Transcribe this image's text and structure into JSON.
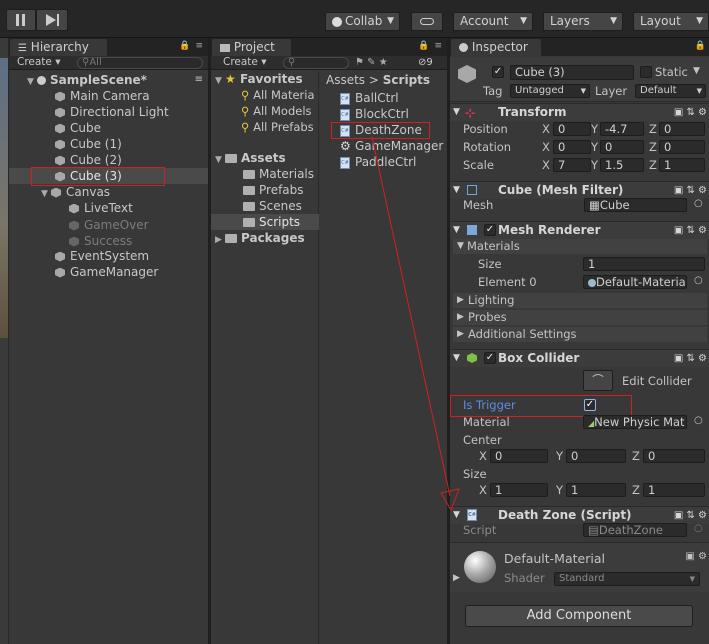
{
  "toolbar": {
    "collab": "Collab",
    "account": "Account",
    "layers": "Layers",
    "layout": "Layout"
  },
  "hierarchy": {
    "tab": "Hierarchy",
    "create": "Create",
    "search_placeholder": "All",
    "scene": "SampleScene*",
    "items": [
      "Main Camera",
      "Directional Light",
      "Cube",
      "Cube (1)",
      "Cube (2)",
      "Cube (3)",
      "Canvas",
      "LiveText",
      "GameOver",
      "Success",
      "EventSystem",
      "GameManager"
    ]
  },
  "project": {
    "tab": "Project",
    "create": "Create",
    "count": "9",
    "favorites": "Favorites",
    "fav_items": [
      "All Materia",
      "All Models",
      "All Prefabs"
    ],
    "assets": "Assets",
    "asset_folders": [
      "Materials",
      "Prefabs",
      "Scenes",
      "Scripts"
    ],
    "packages": "Packages",
    "breadcrumb_root": "Assets",
    "breadcrumb_sep": ">",
    "breadcrumb_current": "Scripts",
    "files": [
      "BallCtrl",
      "BlockCtrl",
      "DeathZone",
      "GameManager",
      "PaddleCtrl"
    ]
  },
  "inspector": {
    "tab": "Inspector",
    "object_name": "Cube (3)",
    "static_label": "Static",
    "tag_label": "Tag",
    "tag_value": "Untagged",
    "layer_label": "Layer",
    "layer_value": "Default",
    "transform": {
      "title": "Transform",
      "position_label": "Position",
      "rotation_label": "Rotation",
      "scale_label": "Scale",
      "axis_x": "X",
      "axis_y": "Y",
      "axis_z": "Z",
      "position": [
        "0",
        "-4.7",
        "0"
      ],
      "rotation": [
        "0",
        "0",
        "0"
      ],
      "scale": [
        "7",
        "1.5",
        "1"
      ]
    },
    "mesh_filter": {
      "title": "Cube (Mesh Filter)",
      "mesh_label": "Mesh",
      "mesh_value": "Cube"
    },
    "mesh_renderer": {
      "title": "Mesh Renderer",
      "materials_label": "Materials",
      "size_label": "Size",
      "size_value": "1",
      "element_label": "Element 0",
      "element_value": "Default-Materia",
      "lighting": "Lighting",
      "probes": "Probes",
      "additional": "Additional Settings"
    },
    "box_collider": {
      "title": "Box Collider",
      "edit_collider": "Edit Collider",
      "is_trigger_label": "Is Trigger",
      "material_label": "Material",
      "material_value": "New Physic Mat",
      "center_label": "Center",
      "center": [
        "0",
        "0",
        "0"
      ],
      "size_label": "Size",
      "size": [
        "1",
        "1",
        "1"
      ]
    },
    "script_component": {
      "title": "Death Zone (Script)",
      "script_label": "Script",
      "script_value": "DeathZone"
    },
    "material": {
      "name": "Default-Material",
      "shader_label": "Shader",
      "shader_value": "Standard"
    },
    "add_component": "Add Component"
  },
  "colors": {
    "highlight": "#d12020",
    "selection": "#4a4a4a",
    "trigger_label": "#5b8ee6"
  }
}
